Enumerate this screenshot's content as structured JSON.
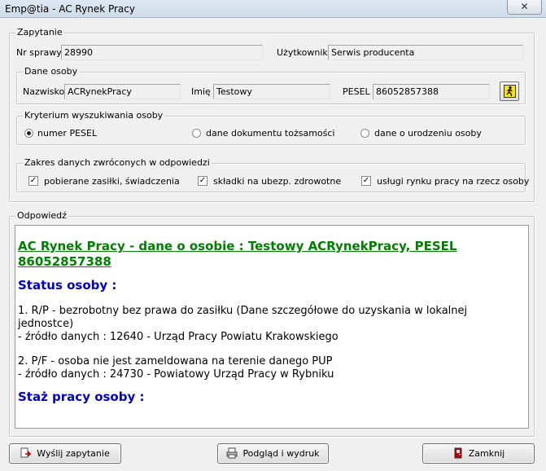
{
  "window": {
    "title": "Emp@tia - AC Rynek Pracy",
    "close_label": "✕"
  },
  "query": {
    "legend": "Zapytanie",
    "case_no_label": "Nr sprawy",
    "case_no_value": "28990",
    "user_label": "Użytkownik",
    "user_value": "Serwis producenta"
  },
  "person": {
    "legend": "Dane osoby",
    "surname_label": "Nazwisko",
    "surname_value": "ACRynekPracy",
    "name_label": "Imię",
    "name_value": "Testowy",
    "pesel_label": "PESEL",
    "pesel_value": "86052857388"
  },
  "criteria": {
    "legend": "Kryterium wyszukiwania osoby",
    "options": [
      {
        "label": "numer PESEL",
        "selected": true
      },
      {
        "label": "dane dokumentu tożsamości",
        "selected": false
      },
      {
        "label": "dane o urodzeniu osoby",
        "selected": false
      }
    ]
  },
  "scope": {
    "legend": "Zakres danych zwróconych w odpowiedzi",
    "options": [
      {
        "label": "pobierane zasiłki, świadczenia",
        "checked": true,
        "mark": "✓"
      },
      {
        "label": "składki na ubezp. zdrowotne",
        "checked": true,
        "mark": "✓"
      },
      {
        "label": "usługi rynku pracy na rzecz osoby",
        "checked": true,
        "mark": "✓"
      }
    ]
  },
  "response": {
    "legend": "Odpowiedź",
    "heading": "AC Rynek Pracy - dane o osobie : Testowy ACRynekPracy, PESEL 86052857388",
    "status_title": "Status osoby :",
    "items": [
      {
        "line": "1. R/P - bezrobotny bez prawa do zasiłku (Dane szczegółowe do uzyskania w lokalnej jednostce)",
        "source": " - źródło danych : 12640 - Urząd Pracy Powiatu Krakowskiego"
      },
      {
        "line": "2. P/F - osoba nie jest zameldowana na terenie danego PUP",
        "source": " - źródło danych : 24730 - Powiatowy Urząd Pracy w Rybniku"
      }
    ],
    "next_section_title": "Staż pracy osoby :"
  },
  "buttons": {
    "send": "Wyślij zapytanie",
    "preview": "Podgląd i wydruk",
    "close": "Zamknij"
  }
}
